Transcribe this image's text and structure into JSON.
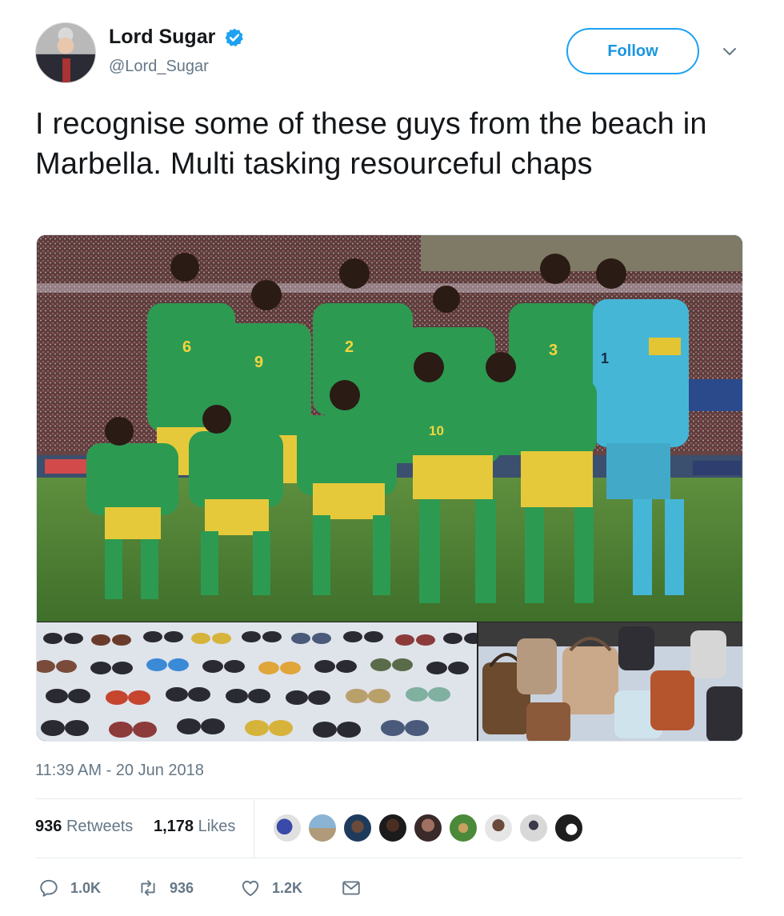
{
  "user": {
    "name": "Lord Sugar",
    "handle": "@Lord_Sugar",
    "verified": true
  },
  "follow_label": "Follow",
  "tweet": {
    "text": "I recognise some of these guys from the beach in Marbella. Multi tasking resourceful chaps",
    "timestamp": "11:39 AM - 20 Jun 2018"
  },
  "media": {
    "team_jersey_numbers": [
      "6",
      "9",
      "2",
      "3",
      "1",
      "10"
    ]
  },
  "stats": {
    "retweets_count": "936",
    "retweets_label": "Retweets",
    "likes_count": "1,178",
    "likes_label": "Likes"
  },
  "actions": {
    "reply_count": "1.0K",
    "retweet_count": "936",
    "like_count": "1.2K"
  },
  "icons": {
    "verified": "verified-badge-icon",
    "caret": "chevron-down-icon",
    "reply": "reply-icon",
    "retweet": "retweet-icon",
    "like": "heart-icon",
    "message": "envelope-icon"
  },
  "colors": {
    "accent": "#1da1f2",
    "follow_text": "#1b95e0",
    "secondary_text": "#657786",
    "primary_text": "#14171a"
  }
}
